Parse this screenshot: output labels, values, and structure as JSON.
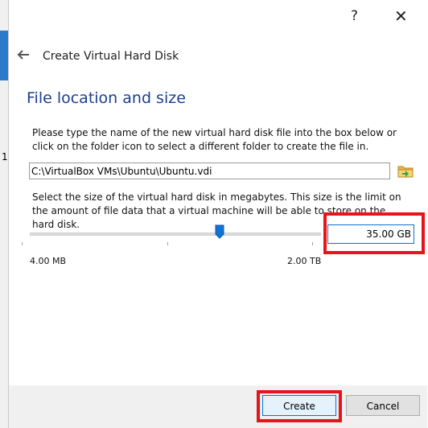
{
  "window": {
    "help_label": "?",
    "close_label": "✕"
  },
  "header": {
    "title": "Create Virtual Hard Disk",
    "back_icon": "back-arrow-icon"
  },
  "section": {
    "title": "File location and size"
  },
  "file_location": {
    "description": "Please type the name of the new virtual hard disk file into the box below or click on the folder icon to select a different folder to create the file in.",
    "path_value": "C:\\VirtualBox VMs\\Ubuntu\\Ubuntu.vdi",
    "folder_icon": "folder-icon"
  },
  "size": {
    "description": "Select the size of the virtual hard disk in megabytes. This size is the limit on the amount of file data that a virtual machine will be able to store on the hard disk.",
    "value": "35.00 GB",
    "min_label": "4.00 MB",
    "max_label": "2.00 TB",
    "slider_fraction": 0.68
  },
  "buttons": {
    "create_label": "Create",
    "cancel_label": "Cancel"
  },
  "colors": {
    "title_blue": "#1b3f8f",
    "highlight_red": "#e8141b",
    "accent_blue": "#0078d7"
  }
}
